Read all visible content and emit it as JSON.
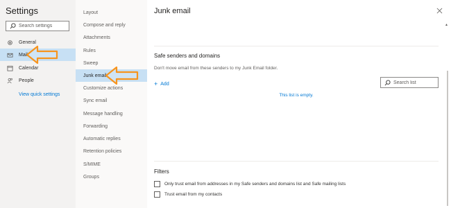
{
  "nav": {
    "title": "Settings",
    "search_placeholder": "Search settings",
    "items": [
      {
        "label": "General",
        "icon": "gear-icon"
      },
      {
        "label": "Mail",
        "icon": "mail-icon"
      },
      {
        "label": "Calendar",
        "icon": "calendar-icon"
      },
      {
        "label": "People",
        "icon": "people-icon"
      }
    ],
    "quick_settings_link": "View quick settings"
  },
  "subnav": {
    "items": [
      {
        "label": "Layout"
      },
      {
        "label": "Compose and reply"
      },
      {
        "label": "Attachments"
      },
      {
        "label": "Rules"
      },
      {
        "label": "Sweep"
      },
      {
        "label": "Junk email"
      },
      {
        "label": "Customize actions"
      },
      {
        "label": "Sync email"
      },
      {
        "label": "Message handling"
      },
      {
        "label": "Forwarding"
      },
      {
        "label": "Automatic replies"
      },
      {
        "label": "Retention policies"
      },
      {
        "label": "S/MIME"
      },
      {
        "label": "Groups"
      }
    ],
    "selected": "Junk email"
  },
  "content": {
    "title": "Junk email",
    "safe_senders": {
      "title": "Safe senders and domains",
      "description": "Don't move email from these senders to my Junk Email folder.",
      "add_label": "Add",
      "search_placeholder": "Search list",
      "empty_text": "This list is empty."
    },
    "filters": {
      "title": "Filters",
      "options": [
        {
          "label": "Only trust email from addresses in my Safe senders and domains list and Safe mailing lists",
          "checked": false
        },
        {
          "label": "Trust email from my contacts",
          "checked": false
        }
      ]
    }
  },
  "colors": {
    "accent": "#0078d4",
    "selected_bg": "#c7e0f4",
    "annotation_arrow": "#f7941d"
  }
}
